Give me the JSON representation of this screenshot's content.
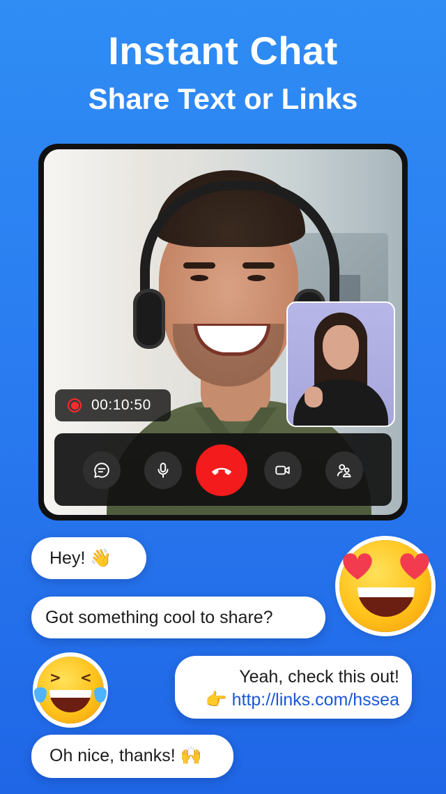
{
  "header": {
    "title": "Instant Chat",
    "subtitle": "Share Text or Links"
  },
  "call": {
    "timer": "00:10:50",
    "controls": [
      {
        "name": "chat",
        "icon": "chat-bubble-icon"
      },
      {
        "name": "microphone",
        "icon": "microphone-icon"
      },
      {
        "name": "end-call",
        "icon": "phone-hangup-icon"
      },
      {
        "name": "camera",
        "icon": "video-camera-icon"
      },
      {
        "name": "participants",
        "icon": "participants-icon"
      }
    ]
  },
  "chat": {
    "messages": [
      {
        "text": "Hey! 👋"
      },
      {
        "text": "Got something cool to share?"
      },
      {
        "line1": "Yeah, check this out!",
        "line2": "👉 http://links.com/hssea"
      },
      {
        "text": "Oh nice, thanks! 🙌"
      }
    ]
  },
  "colors": {
    "background": "#2a7cf0",
    "end_call": "#f31b1b",
    "link": "#1a57d9",
    "recording": "#ff2a2a"
  }
}
